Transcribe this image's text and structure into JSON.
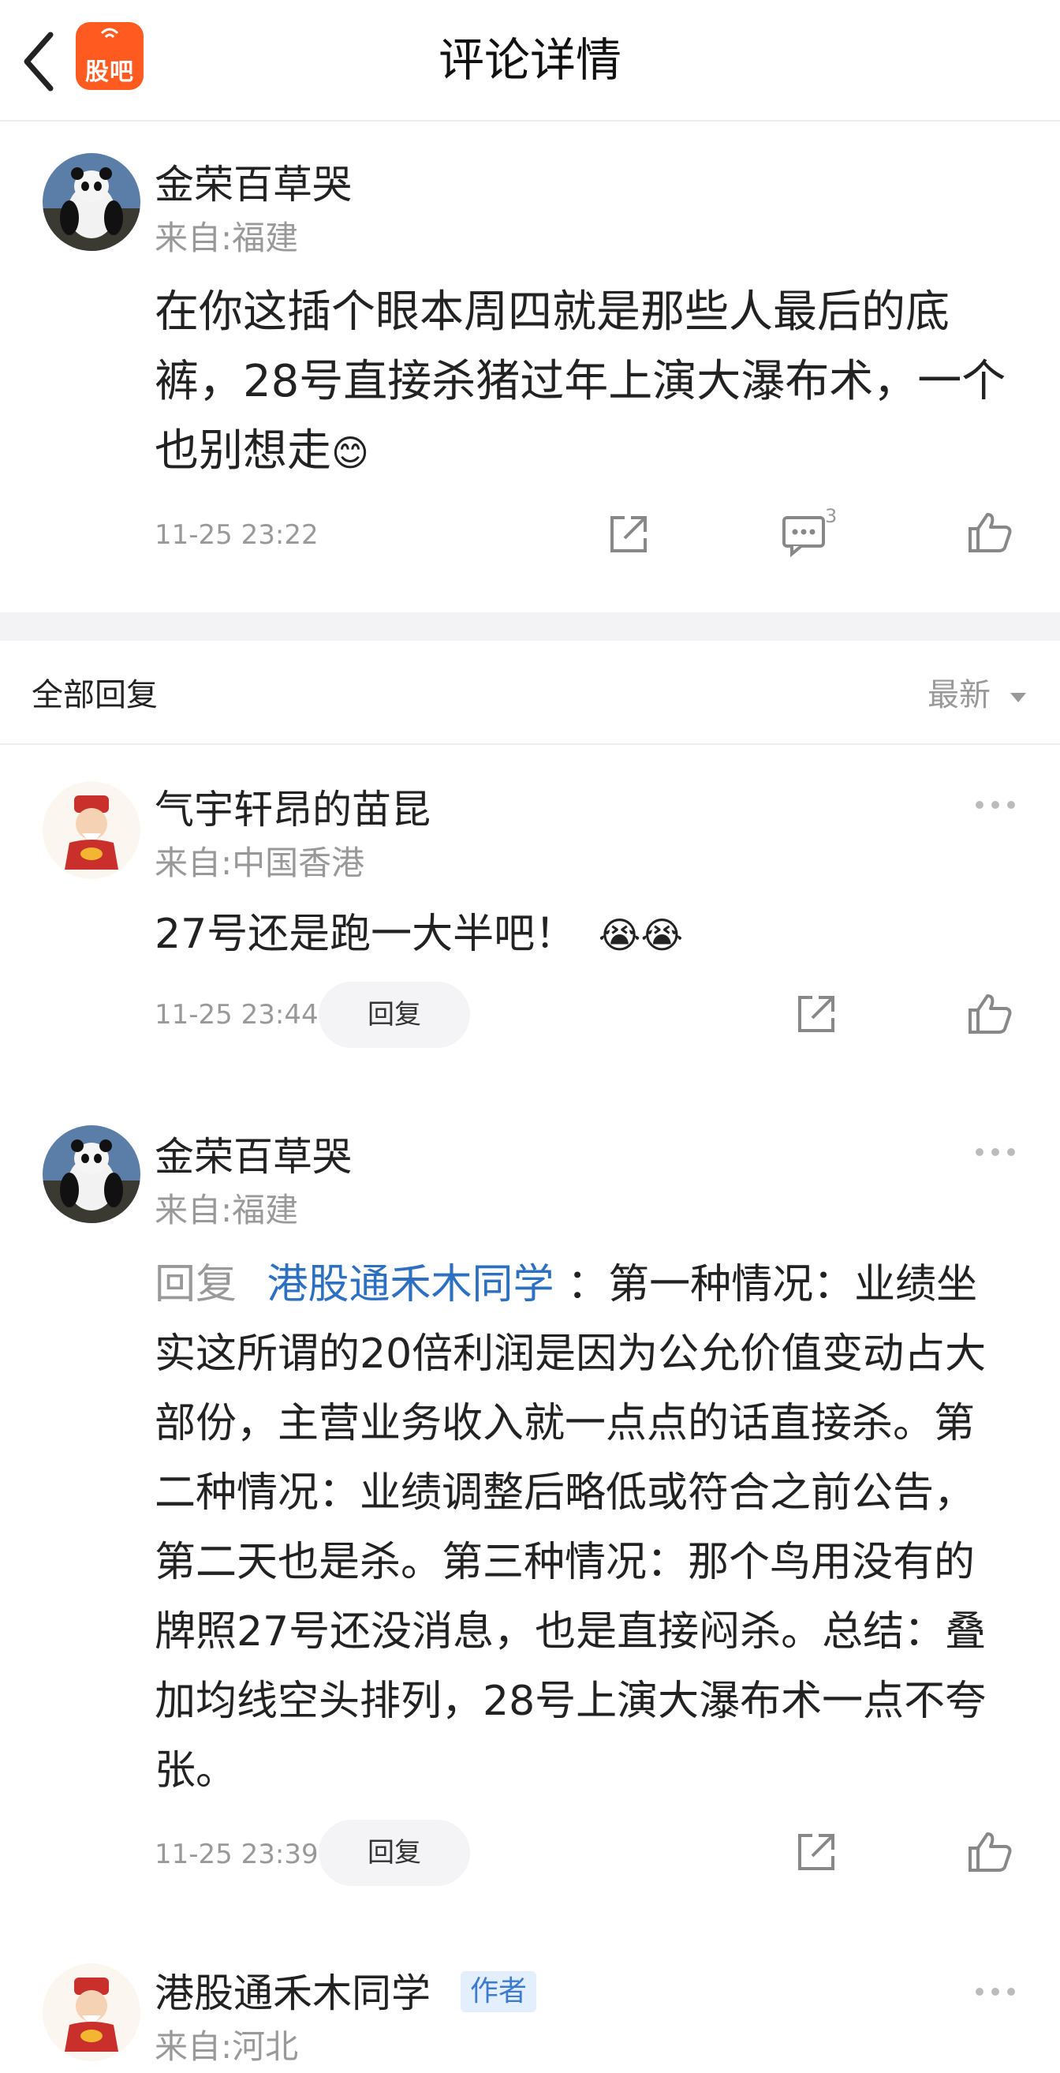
{
  "header": {
    "title": "评论详情",
    "logo_text": "股吧"
  },
  "main_comment": {
    "user": "金荣百草哭",
    "origin": "来自:福建",
    "text": "在你这插个眼本周四就是那些人最后的底裤，28号直接杀猪过年上演大瀑布术，一个也别想走",
    "emoji": "😊",
    "time": "11-25  23:22",
    "comment_count": "3"
  },
  "replies_header": {
    "title": "全部回复",
    "sort_label": "最新"
  },
  "replies": [
    {
      "user": "气宇轩昂的苗昆",
      "origin": "来自:中国香港",
      "text": "27号还是跑一大半吧！",
      "emojis": "😭😭",
      "time": "11-25  23:44",
      "reply_button": "回复"
    },
    {
      "user": "金荣百草哭",
      "origin": "来自:福建",
      "reply_prefix": "回复",
      "mention": "港股通禾木同学",
      "text": "：第一种情况：业绩坐实这所谓的20倍利润是因为公允价值变动占大部份，主营业务收入就一点点的话直接杀。第二种情况：业绩调整后略低或符合之前公告，第二天也是杀。第三种情况：那个鸟用没有的牌照27号还没消息，也是直接闷杀。总结：叠加均线空头排列，28号上演大瀑布术一点不夸张。",
      "time": "11-25  23:39",
      "reply_button": "回复"
    },
    {
      "user": "港股通禾木同学",
      "badge": "作者",
      "origin": "来自:河北"
    }
  ]
}
